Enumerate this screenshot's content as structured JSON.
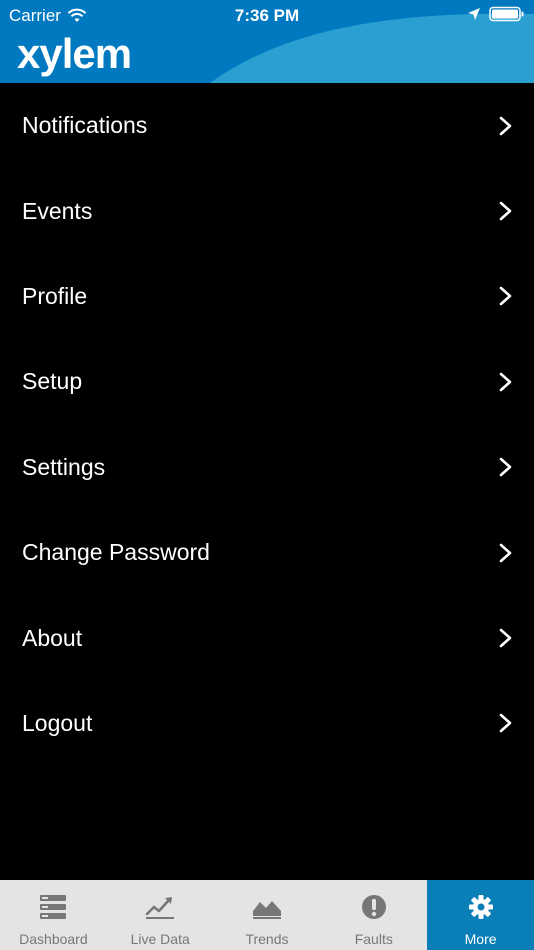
{
  "status_bar": {
    "carrier": "Carrier",
    "time": "7:36 PM"
  },
  "header": {
    "logo": "xylem",
    "brand_color": "#0079c1",
    "wave_color": "#2b9fd2"
  },
  "menu": {
    "items": [
      {
        "label": "Notifications"
      },
      {
        "label": "Events"
      },
      {
        "label": "Profile"
      },
      {
        "label": "Setup"
      },
      {
        "label": "Settings"
      },
      {
        "label": "Change Password"
      },
      {
        "label": "About"
      },
      {
        "label": "Logout"
      }
    ]
  },
  "tabbar": {
    "active": "More",
    "active_color": "#0a7fb7",
    "tabs": [
      {
        "label": "Dashboard",
        "icon": "server-stack-icon"
      },
      {
        "label": "Live Data",
        "icon": "line-trend-icon"
      },
      {
        "label": "Trends",
        "icon": "area-chart-icon"
      },
      {
        "label": "Faults",
        "icon": "alert-circle-icon"
      },
      {
        "label": "More",
        "icon": "gear-icon"
      }
    ]
  }
}
